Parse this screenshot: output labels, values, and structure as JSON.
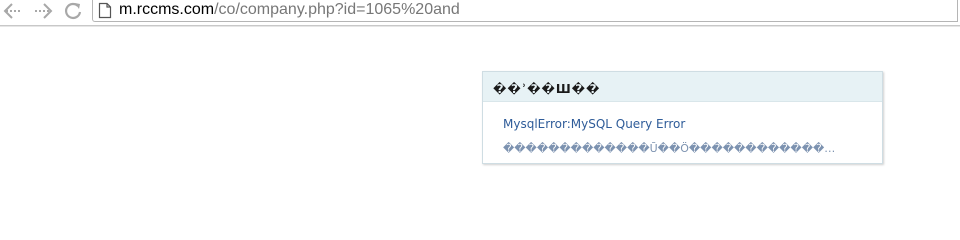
{
  "browser": {
    "address_bar": {
      "host": "m.rccms.com",
      "path": "/co/company.php?id=1065%20and"
    },
    "icons": {
      "back": "arrow-left-icon",
      "forward": "arrow-right-icon",
      "reload": "reload-icon",
      "page": "page-icon"
    }
  },
  "error_dialog": {
    "title": "��ʾ��Ш��",
    "message": "MysqlError:MySQL Query Error",
    "detail": "�������������Ū��Ö������������…"
  },
  "colors": {
    "dialog_header_bg": "#e7f2f5",
    "message_link": "#2f5c99",
    "detail_text": "#7c92b0"
  }
}
